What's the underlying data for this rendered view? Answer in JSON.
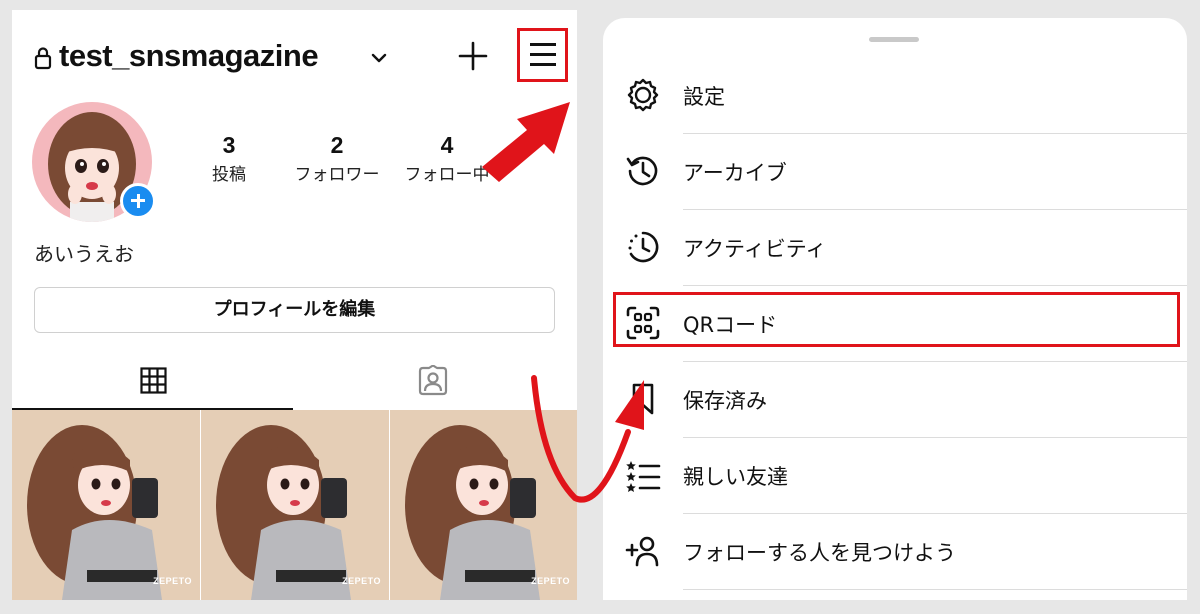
{
  "profile": {
    "username": "test_snsmagazine",
    "bio": "あいうえお",
    "edit_profile_label": "プロフィールを編集",
    "stats": [
      {
        "value": "3",
        "label": "投稿"
      },
      {
        "value": "2",
        "label": "フォロワー"
      },
      {
        "value": "4",
        "label": "フォロー中"
      }
    ],
    "thumbnail_watermark": "ZEPETO"
  },
  "icons": {
    "lock": "lock-icon",
    "dropdown": "chevron-down-icon",
    "create": "plus-icon",
    "menu": "hamburger-menu-icon",
    "grid": "grid-icon",
    "tagged": "tagged-person-icon"
  },
  "menu": {
    "items": [
      {
        "label": "設定",
        "icon": "settings-gear-icon"
      },
      {
        "label": "アーカイブ",
        "icon": "archive-history-icon"
      },
      {
        "label": "アクティビティ",
        "icon": "activity-clock-icon"
      },
      {
        "label": "QRコード",
        "icon": "qr-code-icon"
      },
      {
        "label": "保存済み",
        "icon": "bookmark-icon"
      },
      {
        "label": "親しい友達",
        "icon": "close-friends-list-icon"
      },
      {
        "label": "フォローする人を見つけよう",
        "icon": "add-person-icon"
      }
    ]
  },
  "colors": {
    "highlight_red": "#e0141a",
    "plus_badge_blue": "#1a8cf0",
    "thumbnail_bg": "#e5ceb6"
  }
}
